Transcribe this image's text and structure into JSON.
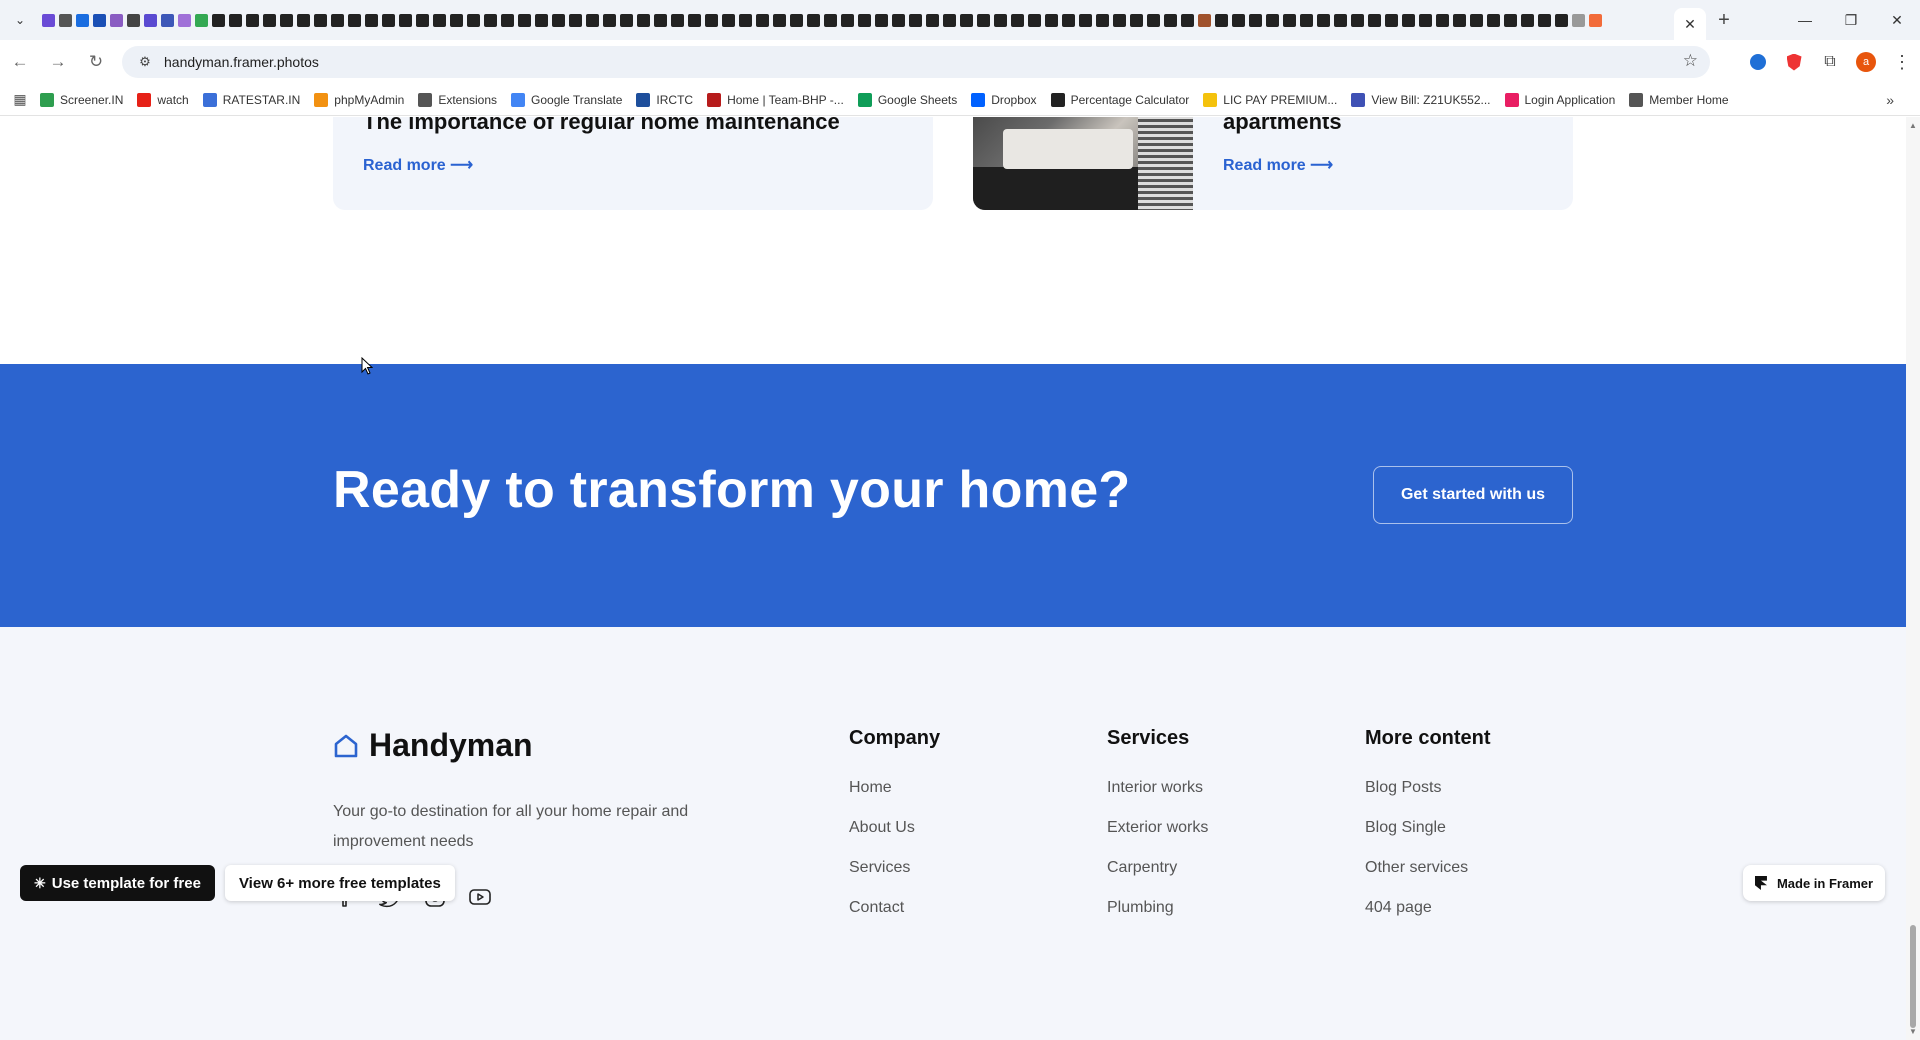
{
  "browser": {
    "active_tab_close": "✕",
    "new_tab": "+",
    "url": "handyman.framer.photos",
    "window": {
      "minimize": "—",
      "restore": "❐",
      "close": "✕"
    },
    "pinned_tab_colors": [
      "#6a4bd6",
      "#555",
      "#1a6de0",
      "#1a4fb5",
      "#8a5cc2",
      "#444",
      "#5a4ad1",
      "#3d57b8",
      "#a070d8",
      "#34a853",
      "#222",
      "#222",
      "#222",
      "#222",
      "#222",
      "#222",
      "#222",
      "#222",
      "#222",
      "#222",
      "#222",
      "#222",
      "#222",
      "#222",
      "#222",
      "#222",
      "#222",
      "#222",
      "#222",
      "#222",
      "#222",
      "#222",
      "#222",
      "#222",
      "#222",
      "#222",
      "#222",
      "#222",
      "#222",
      "#222",
      "#222",
      "#222",
      "#222",
      "#222",
      "#222",
      "#222",
      "#222",
      "#222",
      "#222",
      "#222",
      "#222",
      "#222",
      "#222",
      "#222",
      "#222",
      "#222",
      "#222",
      "#222",
      "#222",
      "#222",
      "#222",
      "#222",
      "#222",
      "#222",
      "#222",
      "#222",
      "#222",
      "#222",
      "#a0522d",
      "#222",
      "#222",
      "#222",
      "#222",
      "#222",
      "#222",
      "#222",
      "#222",
      "#222",
      "#222",
      "#222",
      "#222",
      "#222",
      "#222",
      "#222",
      "#222",
      "#222",
      "#222",
      "#222",
      "#222",
      "#222",
      "#999",
      "#f26b3a"
    ],
    "profile_initial": "a"
  },
  "bookmarks": [
    {
      "label": "Screener.IN",
      "color": "#2e9e4f"
    },
    {
      "label": "watch",
      "color": "#e62117"
    },
    {
      "label": "RATESTAR.IN",
      "color": "#3b6fd8"
    },
    {
      "label": "phpMyAdmin",
      "color": "#f29111"
    },
    {
      "label": "Extensions",
      "color": "#555555"
    },
    {
      "label": "Google Translate",
      "color": "#4285f4"
    },
    {
      "label": "IRCTC",
      "color": "#1e4f9c"
    },
    {
      "label": "Home | Team-BHP -...",
      "color": "#b71c1c"
    },
    {
      "label": "Google Sheets",
      "color": "#0f9d58"
    },
    {
      "label": "Dropbox",
      "color": "#0061ff"
    },
    {
      "label": "Percentage Calculator",
      "color": "#222222"
    },
    {
      "label": "LIC PAY PREMIUM...",
      "color": "#f4c20d"
    },
    {
      "label": "View Bill: Z21UK552...",
      "color": "#3f51b5"
    },
    {
      "label": "Login Application",
      "color": "#e91e63"
    },
    {
      "label": "Member Home",
      "color": "#555555"
    }
  ],
  "blog_cards": [
    {
      "title": "The importance of regular home maintenance",
      "link": "Read more ⟶"
    },
    {
      "title": "apartments",
      "link": "Read more ⟶"
    }
  ],
  "cta": {
    "heading": "Ready to transform your home?",
    "button": "Get started with us"
  },
  "footer": {
    "brand": "Handyman",
    "tagline": "Your go-to destination for all your home repair and improvement needs",
    "columns": [
      {
        "title": "Company",
        "links": [
          "Home",
          "About Us",
          "Services",
          "Contact"
        ]
      },
      {
        "title": "Services",
        "links": [
          "Interior works",
          "Exterior works",
          "Carpentry",
          "Plumbing"
        ]
      },
      {
        "title": "More content",
        "links": [
          "Blog Posts",
          "Blog Single",
          "Other services",
          "404 page"
        ]
      }
    ]
  },
  "framer": {
    "use_template": "Use template for free",
    "more_templates": "View 6+ more free templates",
    "made_in": "Made in Framer"
  },
  "colors": {
    "brand_blue": "#2c64cf",
    "link_blue": "#2a62d1",
    "footer_bg": "#f4f6fb"
  }
}
